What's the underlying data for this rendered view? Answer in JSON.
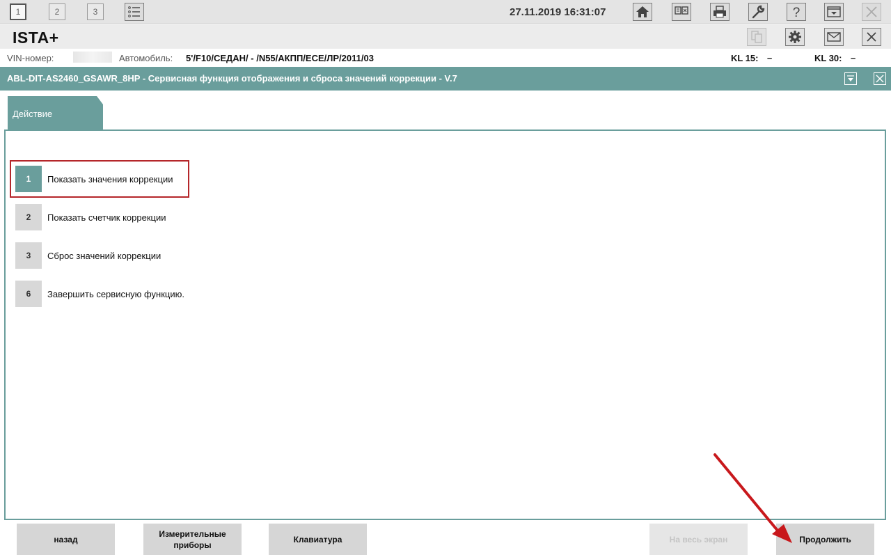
{
  "toolbar": {
    "workspace_tabs": [
      "1",
      "2",
      "3"
    ],
    "datetime": "27.11.2019 16:31:07"
  },
  "app": {
    "title": "ISTA+"
  },
  "vehicle": {
    "vin_label": "VIN-номер:",
    "car_label": "Автомобиль:",
    "car_value": "5'/F10/СЕДАН/ - /N55/АКПП/ECE/ЛР/2011/03",
    "kl15_label": "KL 15:",
    "kl15_value": "–",
    "kl30_label": "KL 30:",
    "kl30_value": "–"
  },
  "dialog": {
    "title": "ABL-DIT-AS2460_GSAWR_8HP - Сервисная функция отображения и сброса значений коррекции - V.7",
    "tab_label": "Действие",
    "options": [
      {
        "num": "1",
        "label": "Показать значения коррекции",
        "selected": true
      },
      {
        "num": "2",
        "label": "Показать счетчик коррекции",
        "selected": false
      },
      {
        "num": "3",
        "label": "Сброс значений коррекции",
        "selected": false
      },
      {
        "num": "6",
        "label": "Завершить сервисную функцию.",
        "selected": false
      }
    ]
  },
  "buttons": {
    "back": "назад",
    "measure_line1": "Измерительные",
    "measure_line2": "приборы",
    "keyboard": "Клавиатура",
    "fullscreen": "На весь экран",
    "continue": "Продолжить"
  },
  "colors": {
    "accent": "#6a9e9c",
    "highlight_frame": "#b5262a",
    "annotation_arrow": "#c8181c"
  }
}
